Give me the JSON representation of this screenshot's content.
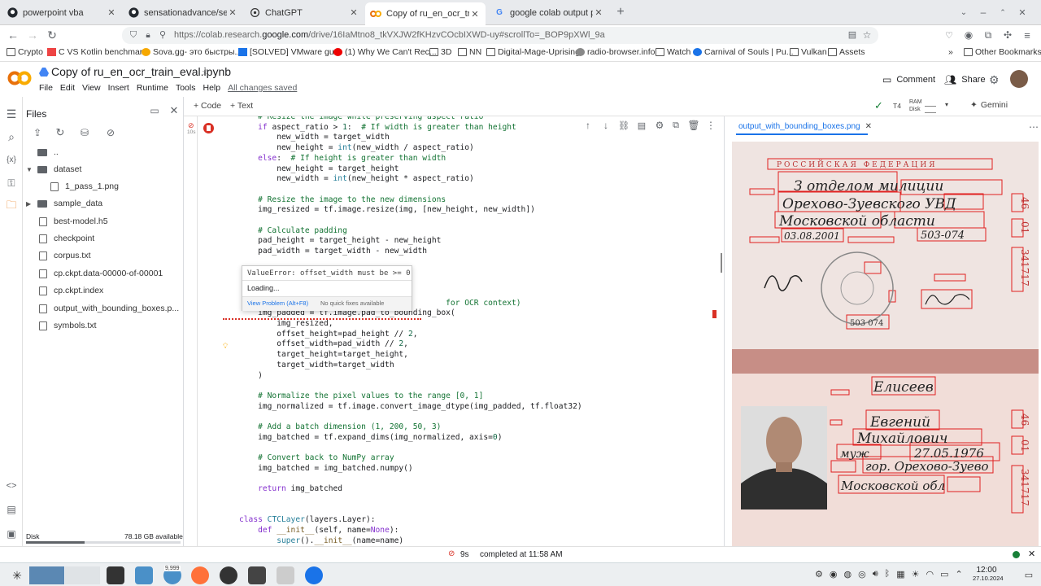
{
  "browser": {
    "tabs": [
      {
        "label": "powerpoint vba",
        "icon": "github-icon",
        "active": false
      },
      {
        "label": "sensationadvance/sensatio",
        "icon": "github-icon",
        "active": false
      },
      {
        "label": "ChatGPT",
        "icon": "chatgpt-icon",
        "active": false
      },
      {
        "label": "Copy of ru_en_ocr_train_ev",
        "icon": "colab-icon",
        "active": true
      },
      {
        "label": "google colab output print",
        "icon": "google-icon",
        "active": false
      }
    ],
    "url_prefix": "https://colab.research.",
    "url_domain": "google.com",
    "url_rest": "/drive/16IaMtno8_tkVXJW2fKHzvCOcbIXWD-uy#scrollTo=_BOP9pXWl_9a",
    "bookmarks": [
      "Crypto",
      "C VS Kotlin benchmar...",
      "Sova.gg- это быстры...",
      "[SOLVED] VMware gu...",
      "(1) Why We Can't Rec...",
      "3D",
      "NN",
      "Digital-Mage-Uprising",
      "radio-browser.info",
      "Watch",
      "Carnival of Souls | Pu...",
      "Vulkan",
      "Assets"
    ],
    "other_bookmarks": "Other Bookmarks"
  },
  "colab": {
    "title": "Copy of ru_en_ocr_train_eval.ipynb",
    "menu": [
      "File",
      "Edit",
      "View",
      "Insert",
      "Runtime",
      "Tools",
      "Help"
    ],
    "saved": "All changes saved",
    "comment": "Comment",
    "share": "Share",
    "add_code": "+ Code",
    "add_text": "+ Text",
    "runtime_type": "T4",
    "ram": "RAM",
    "disk": "Disk",
    "gemini": "Gemini"
  },
  "files": {
    "title": "Files",
    "items": [
      {
        "label": "..",
        "kind": "folder",
        "indent": 0
      },
      {
        "label": "dataset",
        "kind": "folder-open",
        "indent": 0
      },
      {
        "label": "1_pass_1.png",
        "kind": "file",
        "indent": 1
      },
      {
        "label": "sample_data",
        "kind": "folder",
        "indent": 0
      },
      {
        "label": "best-model.h5",
        "kind": "file",
        "indent": 0
      },
      {
        "label": "checkpoint",
        "kind": "file",
        "indent": 0
      },
      {
        "label": "corpus.txt",
        "kind": "file",
        "indent": 0
      },
      {
        "label": "cp.ckpt.data-00000-of-00001",
        "kind": "file",
        "indent": 0
      },
      {
        "label": "cp.ckpt.index",
        "kind": "file",
        "indent": 0
      },
      {
        "label": "output_with_bounding_boxes.p...",
        "kind": "file",
        "indent": 0
      },
      {
        "label": "symbols.txt",
        "kind": "file",
        "indent": 0
      }
    ],
    "disk_label": "Disk",
    "disk_available": "78.18 GB available",
    "disk_used_fraction": 0.38
  },
  "cell": {
    "exec_time": "10s",
    "tooltip_error": "ValueError: offset_width must be >= 0",
    "tooltip_loading": "Loading...",
    "tooltip_view_problem": "View Problem (Alt+F8)",
    "tooltip_no_fixes": "No quick fixes available"
  },
  "output": {
    "tab": "output_with_bounding_boxes.png",
    "doc_header": "РОССИЙСКАЯ ФЕДЕРАЦИЯ",
    "hw_line1": "З отделом милиции",
    "hw_line2": "Орехово-Зуевского УВД",
    "hw_line3": "Московской области",
    "issue_date": "03.08.2001",
    "code": "503-074",
    "side_number": "341717",
    "surname": "Елисеев",
    "name": "Евгений",
    "patronymic": "Михайлович",
    "sex": "муж",
    "birth_date": "27.05.1976",
    "birth_place": "гор. Орехово-Зуево",
    "region": "Московской обл",
    "series_top": "46",
    "series_bottom": "01",
    "stamp_code": "503 074"
  },
  "status": {
    "time": "9s",
    "completed": "completed at 11:58 AM"
  },
  "taskbar": {
    "clock_time": "12:00",
    "clock_date": "27.10.2024",
    "badge": "9,999"
  }
}
